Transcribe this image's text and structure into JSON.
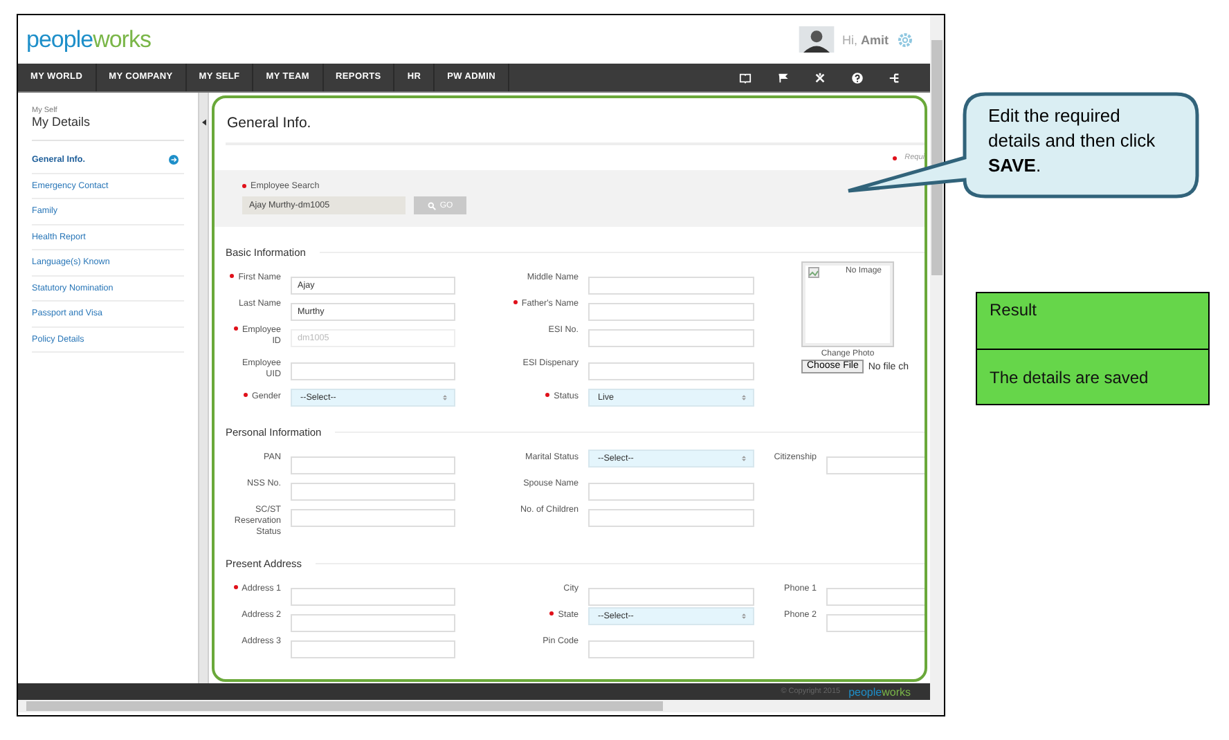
{
  "header": {
    "logo": "peopleworks",
    "greeting": "Hi, **Amit**"
  },
  "nav": {
    "items": [
      "MY WORLD",
      "MY COMPANY",
      "MY SELF",
      "MY TEAM",
      "REPORTS",
      "HR",
      "PW ADMIN"
    ]
  },
  "sidebar": {
    "breadcrumb": "My Self",
    "title": "My Details",
    "items": [
      {
        "label": "General Info.",
        "selected": true
      },
      {
        "label": "Emergency Contact",
        "selected": false
      },
      {
        "label": "Family",
        "selected": false
      },
      {
        "label": "Health Report",
        "selected": false
      },
      {
        "label": "Language(s) Known",
        "selected": false
      },
      {
        "label": "Statutory Nomination",
        "selected": false
      },
      {
        "label": "Passport and Visa",
        "selected": false
      },
      {
        "label": "Policy Details",
        "selected": false
      }
    ]
  },
  "page": {
    "title": "General Info.",
    "required_note": "Requi",
    "employee_search": {
      "label": "Employee Search",
      "required": true,
      "value": "Ajay Murthy-dm1005",
      "button": "GO"
    },
    "sections": [
      {
        "title": "Basic Information",
        "photo": {
          "alt": "No Image",
          "change_label": "Change Photo",
          "file_button": "Choose File",
          "file_status": "No file ch"
        },
        "rows": [
          [
            {
              "label": "First Name",
              "required": true,
              "kind": "text",
              "value": "Ajay"
            },
            {
              "label": "Middle Name",
              "required": false,
              "kind": "text"
            }
          ],
          [
            {
              "label": "Last Name",
              "required": false,
              "kind": "text",
              "value": "Murthy"
            },
            {
              "label": "Father's Name",
              "required": true,
              "kind": "text"
            }
          ],
          [
            {
              "label": "Employee ID",
              "required": true,
              "kind": "readonly",
              "value": "dm1005"
            },
            {
              "label": "ESI No.",
              "required": false,
              "kind": "text"
            }
          ],
          [
            {
              "label": "Employee UID",
              "required": false,
              "kind": "text"
            },
            {
              "label": "ESI Dispenary",
              "required": false,
              "kind": "text"
            }
          ],
          [
            {
              "label": "Gender",
              "required": true,
              "kind": "select",
              "value": "--Select--"
            },
            {
              "label": "Status",
              "required": true,
              "kind": "select",
              "value": "Live"
            }
          ]
        ]
      },
      {
        "title": "Personal Information",
        "rows": [
          [
            {
              "label": "PAN",
              "required": false,
              "kind": "text"
            },
            {
              "label": "Marital Status",
              "required": false,
              "kind": "select",
              "value": "--Select--"
            },
            {
              "label": "Citizenship",
              "required": false,
              "kind": "text"
            }
          ],
          [
            {
              "label": "NSS No.",
              "required": false,
              "kind": "text"
            },
            {
              "label": "Spouse Name",
              "required": false,
              "kind": "text"
            }
          ],
          [
            {
              "label": "SC/ST Reservation Status",
              "required": false,
              "kind": "text"
            },
            {
              "label": "No. of Children",
              "required": false,
              "kind": "text"
            }
          ]
        ]
      },
      {
        "title": "Present Address",
        "rows": [
          [
            {
              "label": "Address 1",
              "required": true,
              "kind": "text"
            },
            {
              "label": "City",
              "required": false,
              "kind": "text"
            },
            {
              "label": "Phone 1",
              "required": false,
              "kind": "text"
            }
          ],
          [
            {
              "label": "Address 2",
              "required": false,
              "kind": "text"
            },
            {
              "label": "State",
              "required": true,
              "kind": "select",
              "value": "--Select--"
            },
            {
              "label": "Phone 2",
              "required": false,
              "kind": "text"
            }
          ],
          [
            {
              "label": "Address 3",
              "required": false,
              "kind": "text"
            },
            {
              "label": "Pin Code",
              "required": false,
              "kind": "text"
            }
          ]
        ]
      }
    ]
  },
  "footer": {
    "copyright": "© Copyright 2015",
    "logo": "peopleworks"
  },
  "callout": {
    "text": "Edit the required details and then click **SAVE**."
  },
  "result_table": {
    "rows": [
      "Result",
      "The details are saved"
    ]
  }
}
